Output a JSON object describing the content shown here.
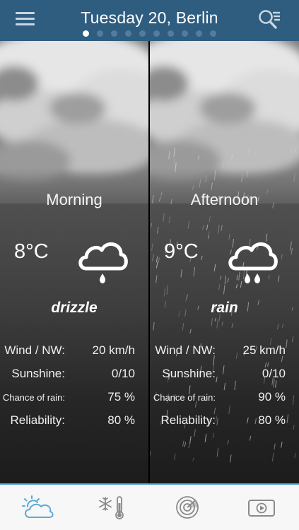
{
  "header": {
    "title": "Tuesday 20, Berlin",
    "page_count": 10,
    "active_page": 0
  },
  "panels": [
    {
      "period": "Morning",
      "temperature": "8°C",
      "condition": "drizzle",
      "icon": "cloud-drizzle-icon",
      "details": [
        {
          "label": "Wind / NW:",
          "value": "20 km/h"
        },
        {
          "label": "Sunshine:",
          "value": "0/10"
        },
        {
          "label": "Chance of rain:",
          "value": "75 %"
        },
        {
          "label": "Reliability:",
          "value": "80 %"
        }
      ]
    },
    {
      "period": "Afternoon",
      "temperature": "9°C",
      "condition": "rain",
      "icon": "cloud-rain-icon",
      "details": [
        {
          "label": "Wind / NW:",
          "value": "25 km/h"
        },
        {
          "label": "Sunshine:",
          "value": "0/10"
        },
        {
          "label": "Chance of rain:",
          "value": "90 %"
        },
        {
          "label": "Reliability:",
          "value": "80 %"
        }
      ]
    }
  ],
  "tabbar": {
    "tabs": [
      {
        "icon": "sun-cloud-icon",
        "active": true
      },
      {
        "icon": "snowflake-thermometer-icon",
        "active": false
      },
      {
        "icon": "radar-icon",
        "active": false
      },
      {
        "icon": "video-play-icon",
        "active": false
      }
    ]
  },
  "colors": {
    "header_bg": "#2e5d80",
    "active_tab": "#5aa9d6",
    "inactive_tab": "#8a8a8a"
  }
}
